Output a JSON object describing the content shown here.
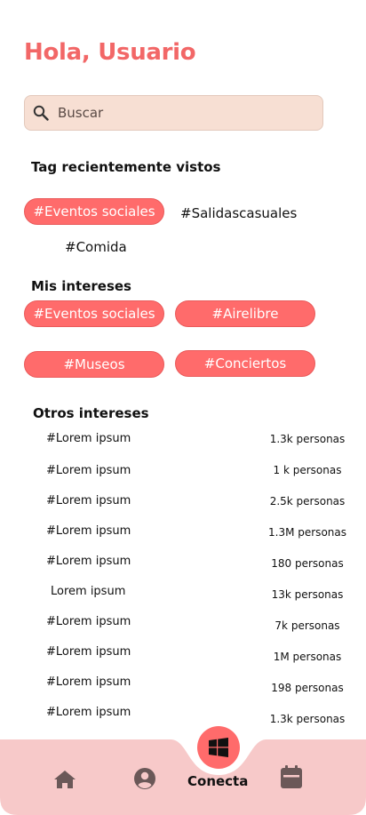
{
  "greeting": "Hola, Usuario",
  "search": {
    "placeholder": "Buscar"
  },
  "recent": {
    "title": "Tag recientemente vistos",
    "chip": "#Eventos sociales",
    "tags": [
      "#Salidascasuales",
      "#Comida"
    ]
  },
  "interests": {
    "title": "Mis intereses",
    "chips": [
      "#Eventos sociales",
      "#Airelibre",
      "#Museos",
      "#Conciertos"
    ]
  },
  "others": {
    "title": "Otros intereses",
    "rows": [
      {
        "name": "#Lorem ipsum",
        "count": "1.3k personas"
      },
      {
        "name": "#Lorem ipsum",
        "count": "1 k personas"
      },
      {
        "name": "#Lorem ipsum",
        "count": "2.5k personas"
      },
      {
        "name": "#Lorem ipsum",
        "count": "1.3M personas"
      },
      {
        "name": "#Lorem ipsum",
        "count": "180 personas"
      },
      {
        "name": "Lorem ipsum",
        "count": "13k personas"
      },
      {
        "name": "#Lorem ipsum",
        "count": "7k personas"
      },
      {
        "name": "#Lorem ipsum",
        "count": "1M personas"
      },
      {
        "name": "#Lorem ipsum",
        "count": "198 personas"
      },
      {
        "name": "#Lorem ipsum",
        "count": "1.3k personas"
      }
    ]
  },
  "nav": {
    "active_label": "Conecta",
    "items": [
      "home-icon",
      "profile-icon",
      "connect-icon",
      "calendar-icon"
    ]
  },
  "colors": {
    "accent": "#ff6b6b",
    "title": "#f26767",
    "search_bg": "#f7dfd3",
    "nav_bg": "#f7c9c9"
  }
}
